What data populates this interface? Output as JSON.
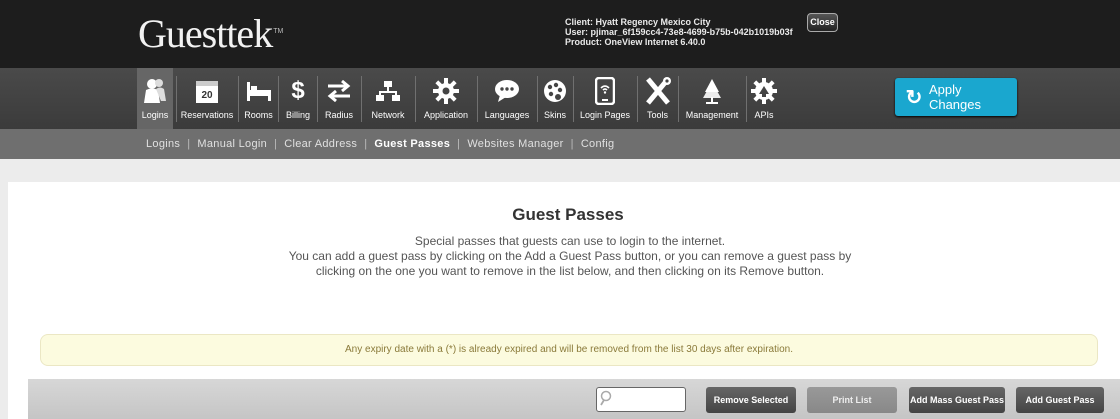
{
  "header": {
    "logo": "Guesttek",
    "logo_tm": "TM",
    "client_line": "Client: Hyatt Regency Mexico City",
    "user_line": "User: pjimar_6f159cc4-73e8-4699-b75b-042b1019b03f",
    "product_line": "Product: OneView Internet 6.40.0",
    "close_label": "Close"
  },
  "nav": {
    "items": [
      {
        "label": "Logins",
        "icon": "users-icon",
        "active": true
      },
      {
        "label": "Reservations",
        "icon": "calendar-icon",
        "calendar_day": "20"
      },
      {
        "label": "Rooms",
        "icon": "bed-icon"
      },
      {
        "label": "Billing",
        "icon": "dollar-icon"
      },
      {
        "label": "Radius",
        "icon": "swap-arrows-icon"
      },
      {
        "label": "Network",
        "icon": "network-icon"
      },
      {
        "label": "Application",
        "icon": "gear-icon"
      },
      {
        "label": "Languages",
        "icon": "speech-bubble-icon"
      },
      {
        "label": "Skins",
        "icon": "palette-icon"
      },
      {
        "label": "Login Pages",
        "icon": "tablet-icon"
      },
      {
        "label": "Tools",
        "icon": "tools-icon"
      },
      {
        "label": "Management",
        "icon": "tree-icon"
      },
      {
        "label": "APIs",
        "icon": "api-gear-icon"
      }
    ],
    "apply_label": "Apply Changes"
  },
  "subnav": {
    "items": [
      {
        "label": "Logins"
      },
      {
        "label": "Manual Login"
      },
      {
        "label": "Clear Address"
      },
      {
        "label": "Guest Passes",
        "active": true
      },
      {
        "label": "Websites Manager"
      },
      {
        "label": "Config"
      }
    ]
  },
  "content": {
    "title": "Guest Passes",
    "desc_line1": "Special passes that guests can use to login to the internet.",
    "desc_line2": "You can add a guest pass by clicking on the Add a Guest Pass button, or you can remove a guest pass by",
    "desc_line3": "clicking on the one you want to remove in the list below, and then clicking on its Remove button.",
    "notice": "Any expiry date with a (*) is already expired and will be removed from the list 30 days after expiration."
  },
  "toolbar": {
    "search_placeholder": "",
    "remove_selected": "Remove Selected",
    "print_list": "Print List",
    "add_mass": "Add Mass Guest Pass",
    "add_guest": "Add Guest Pass"
  },
  "colors": {
    "accent": "#1aa7cf",
    "header_bg": "#1d1d1d",
    "nav_bg": "#444444",
    "subnav_bg": "#6f6f6f",
    "notice_bg": "#fcfbdf"
  }
}
